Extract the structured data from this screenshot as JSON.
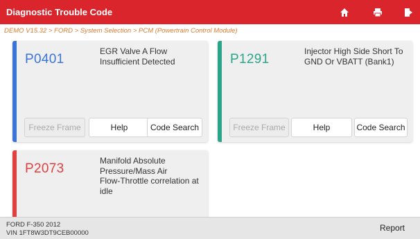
{
  "header": {
    "title": "Diagnostic Trouble Code",
    "icons": [
      "home-icon",
      "print-icon",
      "exit-icon"
    ]
  },
  "breadcrumb": "DEMO V15.32 > FORD > System Selection > PCM (Powertrain Control Module)",
  "colors": {
    "header": "#d9252b",
    "breadcrumb": "#e07a2e",
    "blue": "#3b74d6",
    "green": "#2aa58a",
    "red": "#e0403e"
  },
  "dtcs": [
    {
      "code": "P0401",
      "description": [
        "EGR Valve A Flow",
        "Insufficient Detected"
      ],
      "color": "#3b74d6",
      "buttons": {
        "freeze_frame": "Freeze Frame",
        "help": "Help",
        "code_search": "Code Search"
      }
    },
    {
      "code": "P1291",
      "description": [
        "Injector High Side Short To",
        "GND Or VBATT (Bank1)"
      ],
      "color": "#2aa58a",
      "buttons": {
        "freeze_frame": "Freeze Frame",
        "help": "Help",
        "code_search": "Code Search"
      }
    },
    {
      "code": "P2073",
      "description": [
        "Manifold Absolute",
        "Pressure/Mass Air",
        "Flow-Throttle correlation at",
        "idle"
      ],
      "color": "#e0403e"
    }
  ],
  "footer": {
    "vehicle": "FORD F-350 2012",
    "vin": "VIN 1FT8W3DT9CEB00000",
    "report_label": "Report"
  }
}
